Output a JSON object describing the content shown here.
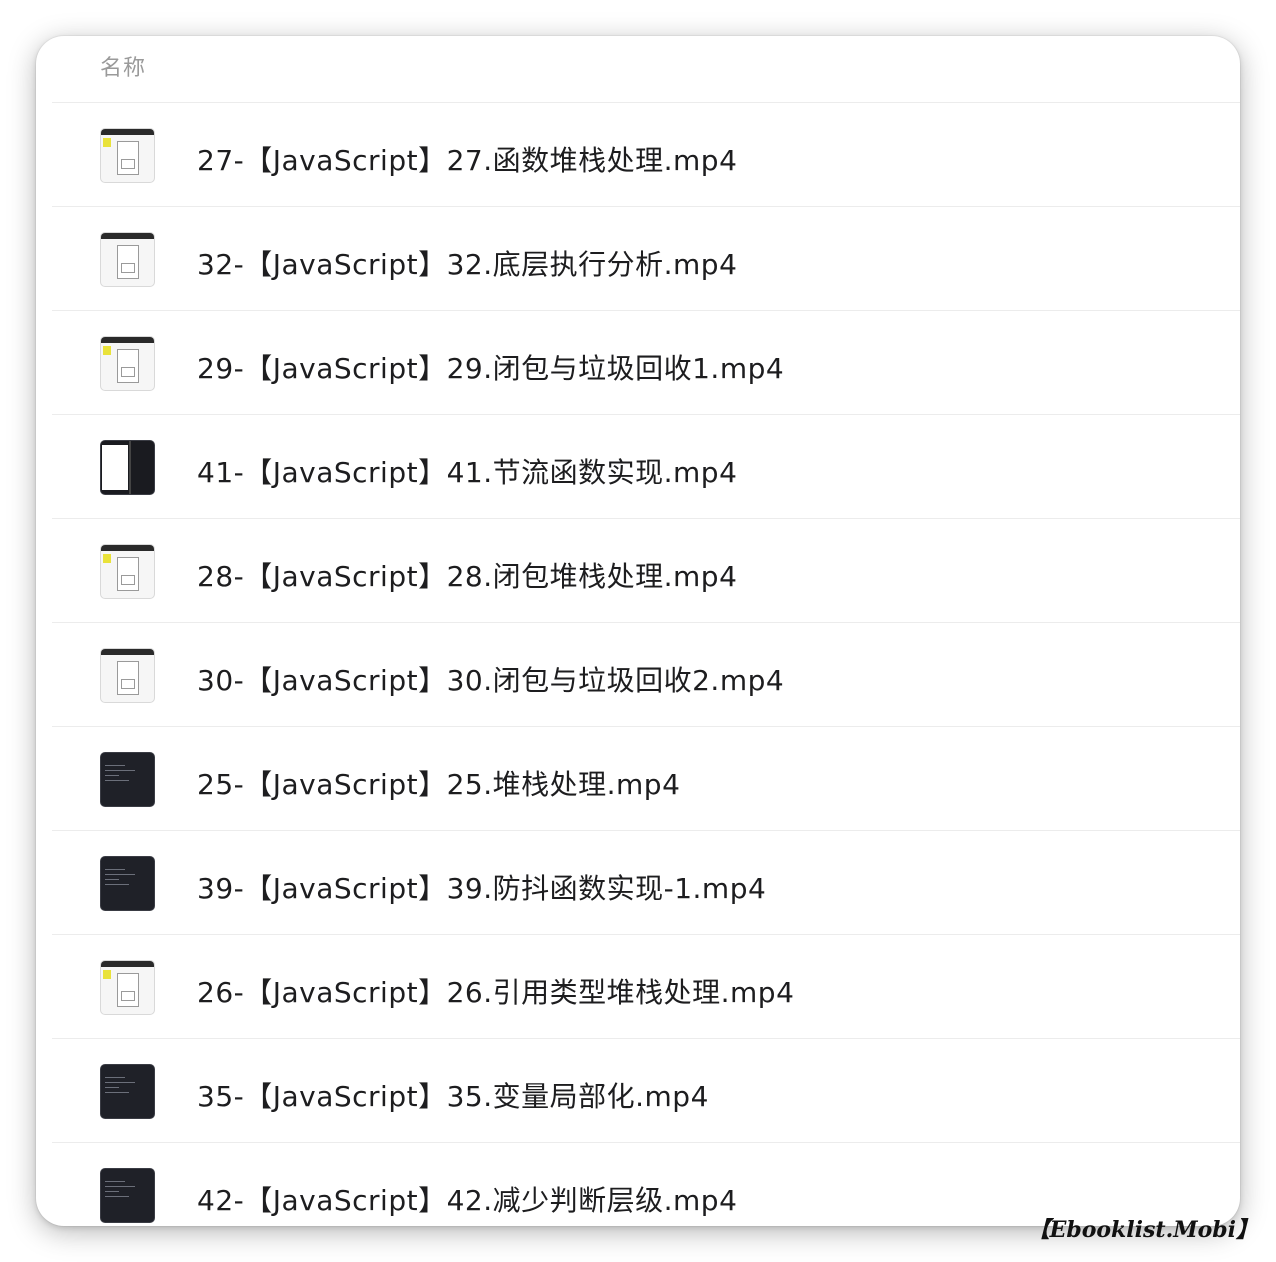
{
  "header": {
    "column_name": "名称"
  },
  "files": [
    {
      "name": "27-【JavaScript】27.函数堆栈处理.mp4",
      "thumb": "light-sticky"
    },
    {
      "name": "32-【JavaScript】32.底层执行分析.mp4",
      "thumb": "light"
    },
    {
      "name": "29-【JavaScript】29.闭包与垃圾回收1.mp4",
      "thumb": "light-sticky"
    },
    {
      "name": "41-【JavaScript】41.节流函数实现.mp4",
      "thumb": "split"
    },
    {
      "name": "28-【JavaScript】28.闭包堆栈处理.mp4",
      "thumb": "light-sticky"
    },
    {
      "name": "30-【JavaScript】30.闭包与垃圾回收2.mp4",
      "thumb": "light"
    },
    {
      "name": "25-【JavaScript】25.堆栈处理.mp4",
      "thumb": "dark"
    },
    {
      "name": "39-【JavaScript】39.防抖函数实现-1.mp4",
      "thumb": "dark"
    },
    {
      "name": "26-【JavaScript】26.引用类型堆栈处理.mp4",
      "thumb": "light-sticky"
    },
    {
      "name": "35-【JavaScript】35.变量局部化.mp4",
      "thumb": "dark"
    },
    {
      "name": "42-【JavaScript】42.减少判断层级.mp4",
      "thumb": "dark"
    }
  ],
  "watermark": "【Ebooklist.Mobi】"
}
